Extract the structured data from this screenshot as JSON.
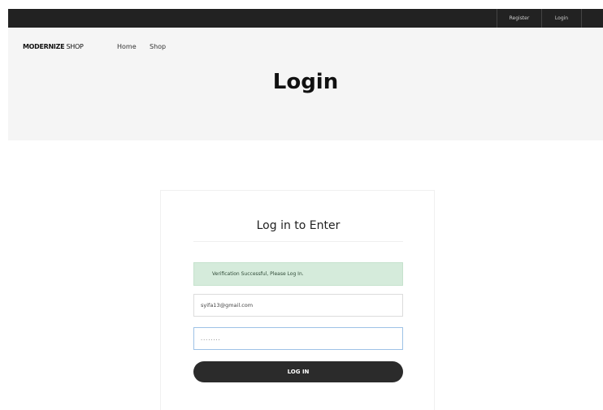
{
  "topbar": {
    "register_label": "Register",
    "login_label": "Login"
  },
  "header": {
    "brand_bold": "MODERNIZE",
    "brand_rest": " SHOP",
    "nav": {
      "home": "Home",
      "shop": "Shop"
    },
    "page_title": "Login"
  },
  "login_card": {
    "title": "Log in to Enter",
    "alert_message": "Verification Successful, Please Log In.",
    "email_value": "syifa13@gmail.com",
    "password_value": "........",
    "submit_label": "LOG IN"
  },
  "colors": {
    "topbar_bg": "#222222",
    "hero_bg": "#f5f5f5",
    "alert_bg": "#d5ebdb",
    "button_bg": "#2b2b2b"
  }
}
